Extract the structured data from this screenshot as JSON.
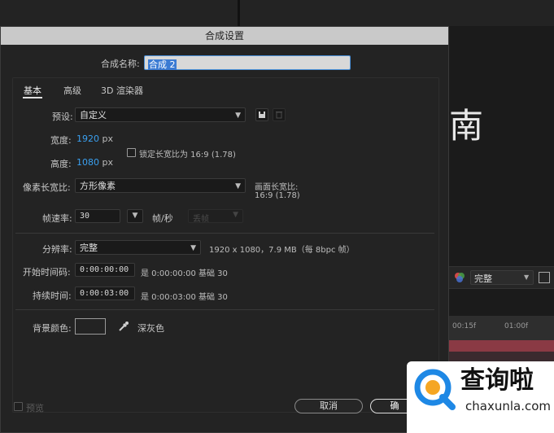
{
  "background": {
    "preview_char": "南",
    "quality_select": "完整",
    "ruler_label_1": "00:15f",
    "ruler_label_2": "01:00f"
  },
  "dialog": {
    "title": "合成设置",
    "name_label": "合成名称:",
    "name_value": "合成 2",
    "tabs": [
      "基本",
      "高级",
      "3D 渲染器"
    ],
    "active_tab": "基本",
    "preset_label": "预设:",
    "preset_value": "自定义",
    "width_label": "宽度:",
    "width_value": "1920",
    "height_label": "高度:",
    "height_value": "1080",
    "unit_px": "px",
    "lock_aspect_label": "锁定长宽比为 16:9 (1.78)",
    "pixel_aspect_label": "像素长宽比:",
    "pixel_aspect_value": "方形像素",
    "frame_aspect_label": "画面长宽比:",
    "frame_aspect_value": "16:9 (1.78)",
    "fps_label": "帧速率:",
    "fps_value": "30",
    "fps_unit": "帧/秒",
    "drop_frame_value": "丢帧",
    "resolution_label": "分辨率:",
    "resolution_value": "完整",
    "resolution_info": "1920 x 1080，7.9 MB（每 8bpc 帧）",
    "start_tc_label": "开始时间码:",
    "start_tc_value": "0:00:00:00",
    "start_tc_info": "是 0:00:00:00  基础 30",
    "duration_label": "持续时间:",
    "duration_value": "0:00:03:00",
    "duration_info": "是 0:00:03:00  基础 30",
    "bg_color_label": "背景颜色:",
    "bg_color_name": "深灰色",
    "preview_label": "预览",
    "cancel_label": "取消",
    "ok_label": "确"
  },
  "watermark": {
    "text": "查询啦",
    "url": "chaxunla.com"
  },
  "colors": {
    "accent_blue": "#3aa0f0",
    "titlebar": "#c9c9c9",
    "dialog_bg": "#232323",
    "track_red": "#8a3a44",
    "watermark_blue": "#1e88e5"
  }
}
